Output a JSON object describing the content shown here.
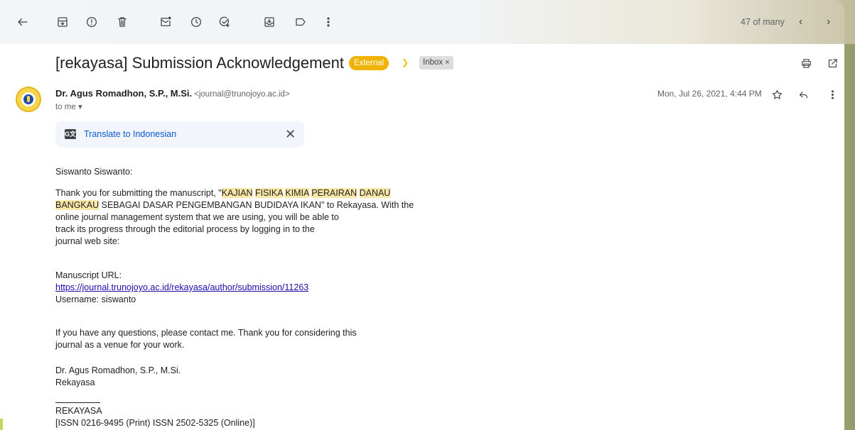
{
  "toolbar": {
    "icons": [
      "back-arrow-icon",
      "archive-icon",
      "report-spam-icon",
      "delete-icon",
      "mark-unread-icon",
      "snooze-icon",
      "add-task-icon",
      "move-to-icon",
      "label-icon",
      "more-vert-icon"
    ],
    "counter": "47 of many",
    "prev": "‹",
    "next": "›"
  },
  "email": {
    "subject": "[rekayasa] Submission Acknowledgement",
    "labels": {
      "external": "External",
      "inbox": "Inbox",
      "inbox_remove": "×"
    },
    "sender_name": "Dr. Agus Romadhon, S.P., M.Si.",
    "sender_email": "<journal@trunojoyo.ac.id>",
    "to": "to me ▾",
    "date": "Mon, Jul 26, 2021, 4:44 PM"
  },
  "translate": {
    "label": "Translate to Indonesian",
    "close": "✕",
    "icon_text": "G文"
  },
  "body": {
    "greeting": "Siswanto Siswanto:",
    "p1_line1_a": "Thank you for submitting the manuscript, \"",
    "p1_kajian": "KAJIAN",
    "p1_fisika": "FISIKA",
    "p1_kimia": "KIMIA",
    "p1_perairan": "PERAIRAN",
    "p1_danau": "DANAU",
    "p1_bangkau": "BANGKAU",
    "p1_line2_rest": " SEBAGAI DASAR PENGEMBANGAN BUDIDAYA IKAN\" to Rekayasa. With the",
    "p1_line3": "online journal management system that we are using, you will be able to",
    "p1_line4": "track its progress through the editorial process by logging in to the",
    "p1_line5": "journal web site:",
    "url_label": "Manuscript URL:",
    "url": "https://journal.trunojoyo.ac.id/rekayasa/author/submission/11263",
    "username": "Username: siswanto",
    "p3_line1": "If you have any questions, please contact me. Thank you for considering this",
    "p3_line2": "journal as a venue for your work.",
    "sig_name": "Dr. Agus Romadhon, S.P., M.Si.",
    "sig_journal": "Rekayasa",
    "footer_name": "REKAYASA",
    "footer_issn": "[ISSN 0216-9495 (Print) ISSN 2502-5325 (Online)]"
  }
}
